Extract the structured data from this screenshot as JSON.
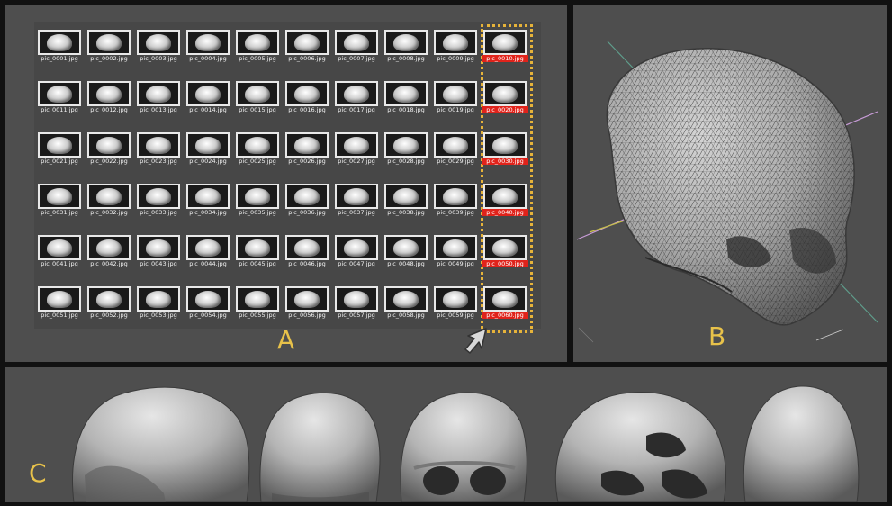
{
  "panel_a": {
    "letter": "A",
    "thumbnails": [
      {
        "label": "pic_0001.jpg",
        "selected": false
      },
      {
        "label": "pic_0002.jpg",
        "selected": false
      },
      {
        "label": "pic_0003.jpg",
        "selected": false
      },
      {
        "label": "pic_0004.jpg",
        "selected": false
      },
      {
        "label": "pic_0005.jpg",
        "selected": false
      },
      {
        "label": "pic_0006.jpg",
        "selected": false
      },
      {
        "label": "pic_0007.jpg",
        "selected": false
      },
      {
        "label": "pic_0008.jpg",
        "selected": false
      },
      {
        "label": "pic_0009.jpg",
        "selected": false
      },
      {
        "label": "pic_0010.jpg",
        "selected": true
      },
      {
        "label": "pic_0011.jpg",
        "selected": false
      },
      {
        "label": "pic_0012.jpg",
        "selected": false
      },
      {
        "label": "pic_0013.jpg",
        "selected": false
      },
      {
        "label": "pic_0014.jpg",
        "selected": false
      },
      {
        "label": "pic_0015.jpg",
        "selected": false
      },
      {
        "label": "pic_0016.jpg",
        "selected": false
      },
      {
        "label": "pic_0017.jpg",
        "selected": false
      },
      {
        "label": "pic_0018.jpg",
        "selected": false
      },
      {
        "label": "pic_0019.jpg",
        "selected": false
      },
      {
        "label": "pic_0020.jpg",
        "selected": true
      },
      {
        "label": "pic_0021.jpg",
        "selected": false
      },
      {
        "label": "pic_0022.jpg",
        "selected": false
      },
      {
        "label": "pic_0023.jpg",
        "selected": false
      },
      {
        "label": "pic_0024.jpg",
        "selected": false
      },
      {
        "label": "pic_0025.jpg",
        "selected": false
      },
      {
        "label": "pic_0026.jpg",
        "selected": false
      },
      {
        "label": "pic_0027.jpg",
        "selected": false
      },
      {
        "label": "pic_0028.jpg",
        "selected": false
      },
      {
        "label": "pic_0029.jpg",
        "selected": false
      },
      {
        "label": "pic_0030.jpg",
        "selected": true
      },
      {
        "label": "pic_0031.jpg",
        "selected": false
      },
      {
        "label": "pic_0032.jpg",
        "selected": false
      },
      {
        "label": "pic_0033.jpg",
        "selected": false
      },
      {
        "label": "pic_0034.jpg",
        "selected": false
      },
      {
        "label": "pic_0035.jpg",
        "selected": false
      },
      {
        "label": "pic_0036.jpg",
        "selected": false
      },
      {
        "label": "pic_0037.jpg",
        "selected": false
      },
      {
        "label": "pic_0038.jpg",
        "selected": false
      },
      {
        "label": "pic_0039.jpg",
        "selected": false
      },
      {
        "label": "pic_0040.jpg",
        "selected": true
      },
      {
        "label": "pic_0041.jpg",
        "selected": false
      },
      {
        "label": "pic_0042.jpg",
        "selected": false
      },
      {
        "label": "pic_0043.jpg",
        "selected": false
      },
      {
        "label": "pic_0044.jpg",
        "selected": false
      },
      {
        "label": "pic_0045.jpg",
        "selected": false
      },
      {
        "label": "pic_0046.jpg",
        "selected": false
      },
      {
        "label": "pic_0047.jpg",
        "selected": false
      },
      {
        "label": "pic_0048.jpg",
        "selected": false
      },
      {
        "label": "pic_0049.jpg",
        "selected": false
      },
      {
        "label": "pic_0050.jpg",
        "selected": true
      },
      {
        "label": "pic_0051.jpg",
        "selected": false
      },
      {
        "label": "pic_0052.jpg",
        "selected": false
      },
      {
        "label": "pic_0053.jpg",
        "selected": false
      },
      {
        "label": "pic_0054.jpg",
        "selected": false
      },
      {
        "label": "pic_0055.jpg",
        "selected": false
      },
      {
        "label": "pic_0056.jpg",
        "selected": false
      },
      {
        "label": "pic_0057.jpg",
        "selected": false
      },
      {
        "label": "pic_0058.jpg",
        "selected": false
      },
      {
        "label": "pic_0059.jpg",
        "selected": false
      },
      {
        "label": "pic_0060.jpg",
        "selected": true
      }
    ]
  },
  "panel_b": {
    "letter": "B"
  },
  "panel_c": {
    "letter": "C"
  },
  "colors": {
    "panel_bg": "#4e4e4e",
    "selection_label": "#e0231b",
    "selection_outline": "#e6b33a",
    "letter": "#e8c24a",
    "axis_green": "#5f9e8c",
    "axis_magenta": "#c79bd6",
    "axis_yellow": "#c8c04a"
  },
  "icons": {
    "cursor": "arrow-cursor-icon",
    "mesh": "skull-wireframe-mesh",
    "renders": "skull-render-views"
  }
}
